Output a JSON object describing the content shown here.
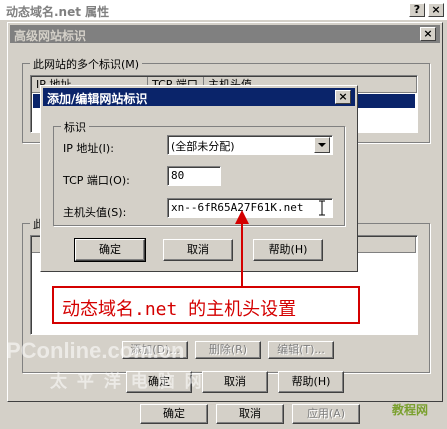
{
  "props": {
    "title": "动态域名.net 属性",
    "help": "?",
    "close": "×"
  },
  "adv": {
    "title": "高级网站标识",
    "close": "×",
    "group1": "此网站的多个标识(M)",
    "cols": [
      "IP 地址",
      "TCP 端口",
      "主机头值"
    ],
    "group2_partial": "此",
    "add": "添加(D)...",
    "remove": "删除(R)",
    "edit": "编辑(T)...",
    "ok": "确定",
    "cancel": "取消",
    "help": "帮助(H)"
  },
  "dialog": {
    "title": "添加/编辑网站标识",
    "close": "×",
    "group": "标识",
    "ip_label": "IP 地址(I):",
    "ip_value": "(全部未分配)",
    "port_label": "TCP 端口(O):",
    "port_value": "80",
    "host_label": "主机头值(S):",
    "host_value": "xn--6fR65A27F61K.net",
    "ok": "确定",
    "cancel": "取消",
    "help": "帮助(H)"
  },
  "props_buttons": {
    "ok": "确定",
    "cancel": "取消",
    "apply": "应用(A)"
  },
  "annotation": {
    "text": "动态域名.net 的主机头设置",
    "color": "#d40000"
  },
  "watermark": {
    "logo": "PConline.com.cn",
    "sub": "太 平 洋 电 脑 网",
    "corner": "教程网"
  }
}
